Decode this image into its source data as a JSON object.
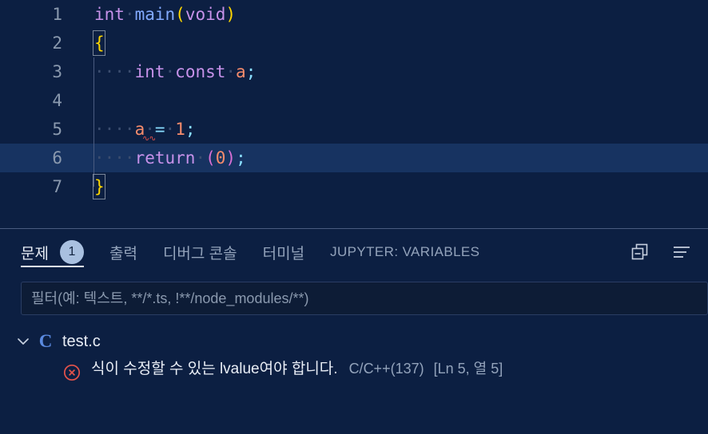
{
  "editor": {
    "language": "c",
    "lines": [
      {
        "num": "1",
        "indent": 0,
        "tokens": [
          {
            "t": "int",
            "c": "t-type"
          },
          {
            "t": "·",
            "c": "ws"
          },
          {
            "t": "main",
            "c": "t-fn"
          },
          {
            "t": "(",
            "c": "t-paren-y"
          },
          {
            "t": "void",
            "c": "t-kw"
          },
          {
            "t": ")",
            "c": "t-paren-y"
          }
        ]
      },
      {
        "num": "2",
        "indent": 0,
        "tokens": [
          {
            "t": "{",
            "c": "t-brace"
          }
        ]
      },
      {
        "num": "3",
        "indent": 1,
        "tokens": [
          {
            "t": "····",
            "c": "ws"
          },
          {
            "t": "int",
            "c": "t-type"
          },
          {
            "t": "·",
            "c": "ws"
          },
          {
            "t": "const",
            "c": "t-type"
          },
          {
            "t": "·",
            "c": "ws"
          },
          {
            "t": "a",
            "c": "t-var"
          },
          {
            "t": ";",
            "c": "t-punc"
          }
        ]
      },
      {
        "num": "4",
        "indent": 1,
        "tokens": []
      },
      {
        "num": "5",
        "indent": 1,
        "tokens": [
          {
            "t": "····",
            "c": "ws"
          },
          {
            "t": "a",
            "c": "t-var"
          },
          {
            "t": "·",
            "c": "ws"
          },
          {
            "t": "=",
            "c": "t-op"
          },
          {
            "t": "·",
            "c": "ws"
          },
          {
            "t": "1",
            "c": "t-num"
          },
          {
            "t": ";",
            "c": "t-punc"
          }
        ]
      },
      {
        "num": "6",
        "indent": 1,
        "active": true,
        "tokens": [
          {
            "t": "····",
            "c": "ws"
          },
          {
            "t": "return",
            "c": "t-kw"
          },
          {
            "t": "·",
            "c": "ws"
          },
          {
            "t": "(",
            "c": "t-paren-p"
          },
          {
            "t": "0",
            "c": "t-num"
          },
          {
            "t": ")",
            "c": "t-paren-p"
          },
          {
            "t": ";",
            "c": "t-punc"
          }
        ]
      },
      {
        "num": "7",
        "indent": 0,
        "tokens": [
          {
            "t": "}",
            "c": "t-brace"
          }
        ]
      }
    ]
  },
  "panel": {
    "tabs": [
      {
        "label": "문제",
        "active": true,
        "badge": "1"
      },
      {
        "label": "출력",
        "active": false
      },
      {
        "label": "디버그 콘솔",
        "active": false
      },
      {
        "label": "터미널",
        "active": false
      },
      {
        "label": "JUPYTER: VARIABLES",
        "active": false,
        "upper": true
      }
    ],
    "actions": [
      {
        "name": "collapse-all-icon",
        "title": "모두 축소"
      },
      {
        "name": "view-options-icon",
        "title": "보기 및 정렬"
      }
    ],
    "filter": {
      "value": "",
      "placeholder": "필터(예: 텍스트, **/*.ts, !**/node_modules/**)"
    },
    "problems": {
      "file": {
        "name": "test.c",
        "icon": "C",
        "expanded": true
      },
      "items": [
        {
          "severity": "error",
          "message": "식이 수정할 수 있는 lvalue여야 합니다.",
          "source": "C/C++(137)",
          "location": "[Ln 5, 열 5]"
        }
      ]
    }
  },
  "colors": {
    "background": "#0c1f42",
    "active_line": "#173361",
    "accent": "#a9c0e0",
    "error": "#e5534b",
    "file_icon": "#5b8ae0"
  }
}
